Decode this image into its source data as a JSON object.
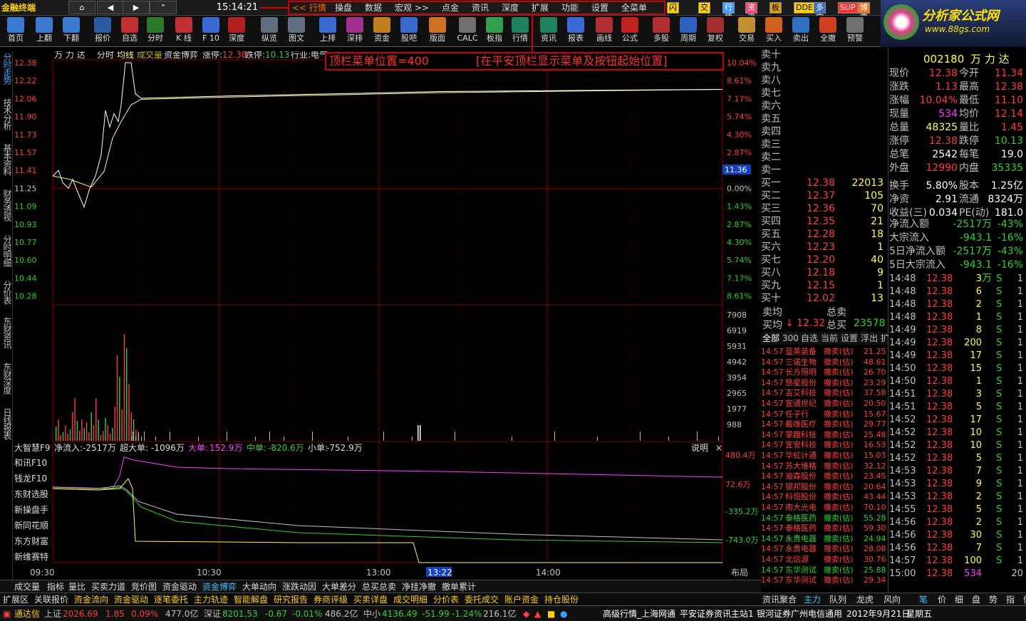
{
  "app": {
    "logo": "金融终端",
    "clock": "15:14:21",
    "nav": [
      "⌂",
      "◀",
      "▶",
      "⌃"
    ]
  },
  "topmenu": [
    "<< 行情",
    "操盘",
    "数据",
    "宏观 >>",
    "点金",
    "资讯",
    "深度",
    "扩展",
    "功能",
    "设置",
    "全菜单"
  ],
  "badges": [
    "闪电手",
    "交易",
    "行情",
    "资讯",
    "板指",
    "DDE",
    "多空",
    "SUP",
    "博弈"
  ],
  "brand": {
    "title": "分析家公式网",
    "url": "www.88gs.com"
  },
  "toolbar": [
    {
      "label": "首页",
      "color": "#3a7ad0"
    },
    {
      "label": "上翻",
      "color": "#3a7ad0"
    },
    {
      "label": "下翻",
      "color": "#3a7ad0"
    },
    {
      "label": "报价",
      "color": "#2a5aa0"
    },
    {
      "label": "自选",
      "color": "#c03030"
    },
    {
      "label": "分时",
      "color": "#2a7a2a"
    },
    {
      "label": "K 线",
      "color": "#c03030"
    },
    {
      "label": "F 10",
      "color": "#3a6ad0"
    },
    {
      "label": "深度",
      "color": "#b02020"
    },
    {
      "label": "纵览",
      "color": "#607080"
    },
    {
      "label": "图文",
      "color": "#607080"
    },
    {
      "label": "上排",
      "color": "#3a6ad0"
    },
    {
      "label": "深排",
      "color": "#a03090"
    },
    {
      "label": "资金",
      "color": "#c08020"
    },
    {
      "label": "股吧",
      "color": "#3a6ad0"
    },
    {
      "label": "版面",
      "color": "#d07020"
    },
    {
      "label": "CALC",
      "color": "#707070"
    },
    {
      "label": "板指",
      "color": "#30a050"
    },
    {
      "label": "行情",
      "color": "#208060"
    },
    {
      "label": "资讯",
      "color": "#208060"
    },
    {
      "label": "报表",
      "color": "#3a6ad0"
    },
    {
      "label": "画线",
      "color": "#b03030"
    },
    {
      "label": "公式",
      "color": "#c02020"
    },
    {
      "label": "多股",
      "color": "#b03030"
    },
    {
      "label": "周期",
      "color": "#3060c0"
    },
    {
      "label": "复权",
      "color": "#a03030"
    },
    {
      "label": "交易",
      "color": "#c09030"
    },
    {
      "label": "买入",
      "color": "#d06020"
    },
    {
      "label": "卖出",
      "color": "#3070c0"
    },
    {
      "label": "全撤",
      "color": "#d04020"
    },
    {
      "label": "预警",
      "color": "#707070"
    }
  ],
  "sidebar": [
    "分时走势",
    "技术分析",
    "基本资料",
    "财务透视",
    "分时明细",
    "分价表",
    "东财资讯",
    "东财深度",
    "日线报表"
  ],
  "overlay": {
    "left": "顶栏菜单位置=400",
    "right": "[在平安顶栏显示菜单及按钮起始位置]"
  },
  "chart_header": {
    "name": "万 力 达",
    "tabs": [
      "分时",
      "均线",
      "成交量",
      "资金博弈"
    ],
    "zt_label": "涨停:",
    "zt": "12.38",
    "dt_label": "跌停:",
    "dt": "10.13",
    "industry": "行业:电气"
  },
  "price_axis": [
    "12.38",
    "12.22",
    "12.06",
    "11.90",
    "11.73",
    "11.57",
    "11.41",
    "11.25",
    "11.09",
    "10.93",
    "10.77",
    "10.60",
    "10.44",
    "10.28"
  ],
  "pct_axis": [
    "10.04%",
    "8.61%",
    "7.17%",
    "5.74%",
    "4.30%",
    "2.87%",
    "1.43%",
    "0.00%",
    "1.43%",
    "2.87%",
    "4.30%",
    "5.74%",
    "7.17%",
    "8.61%"
  ],
  "vol_axis": [
    "7908",
    "6919",
    "5931",
    "4942",
    "3954",
    "2965",
    "1977",
    "988"
  ],
  "last_price_tag": "11.36",
  "fund_header": {
    "title": "大智慧F9",
    "net_label": "净流入:",
    "net": "-2517万",
    "super_label": "超大单:",
    "super": "-1096万",
    "big_label": "大单:",
    "big": "152.9万",
    "mid_label": "中单:",
    "mid": "-820.6万",
    "small_label": "小单:",
    "small": "-752.9万",
    "explain": "说明"
  },
  "fund_axis": [
    "480.4万",
    "72.6万",
    "-335.2万",
    "-743.0万"
  ],
  "fund_side": [
    "和讯F10",
    "钱龙F10",
    "东财选股",
    "新操盘手",
    "新同花顺",
    "东方财富",
    "新维赛特"
  ],
  "time_axis": [
    "09:30",
    "10:30",
    "13:00",
    "13:22",
    "14:00",
    "布局"
  ],
  "chart_data": {
    "type": "line",
    "x": [
      "09:30",
      "10:30",
      "13:00",
      "14:00",
      "15:00"
    ],
    "series": [
      {
        "name": "分时",
        "values": [
          11.36,
          12.06,
          12.12,
          12.14,
          12.38
        ]
      },
      {
        "name": "均线",
        "values": [
          11.3,
          12.02,
          12.1,
          12.13,
          12.14
        ]
      }
    ],
    "ylim": [
      10.13,
      12.38
    ]
  },
  "sell_book": [
    {
      "label": "卖十"
    },
    {
      "label": "卖九"
    },
    {
      "label": "卖八"
    },
    {
      "label": "卖七"
    },
    {
      "label": "卖六"
    },
    {
      "label": "卖五"
    },
    {
      "label": "卖四"
    },
    {
      "label": "卖三"
    },
    {
      "label": "卖二"
    },
    {
      "label": "卖一"
    }
  ],
  "buy_book": [
    {
      "label": "买一",
      "price": "12.38",
      "vol": "22013"
    },
    {
      "label": "买二",
      "price": "12.37",
      "vol": "105"
    },
    {
      "label": "买三",
      "price": "12.36",
      "vol": "70"
    },
    {
      "label": "买四",
      "price": "12.35",
      "vol": "21"
    },
    {
      "label": "买五",
      "price": "12.28",
      "vol": "18"
    },
    {
      "label": "买六",
      "price": "12.23",
      "vol": "1"
    },
    {
      "label": "买七",
      "price": "12.20",
      "vol": "40"
    },
    {
      "label": "买八",
      "price": "12.18",
      "vol": "9"
    },
    {
      "label": "买九",
      "price": "12.15",
      "vol": "1"
    },
    {
      "label": "买十",
      "price": "12.02",
      "vol": "13"
    }
  ],
  "book_summary": {
    "sell_avg": "卖均",
    "total_sell": "总卖",
    "buy_avg": "买均",
    "buy_avg_val": "↓ 12.32",
    "total_buy": "总买",
    "total_buy_val": "23578"
  },
  "stock_title": {
    "code": "002180",
    "name": "万 力 达"
  },
  "quote": [
    {
      "k1": "现价",
      "v1": "12.38",
      "c1": "red",
      "k2": "今开",
      "v2": "11.34",
      "c2": "red"
    },
    {
      "k1": "涨跌",
      "v1": "1.13",
      "c1": "red",
      "k2": "最高",
      "v2": "12.38",
      "c2": "red"
    },
    {
      "k1": "涨幅",
      "v1": "10.04%",
      "c1": "red",
      "k2": "最低",
      "v2": "11.10",
      "c2": "red"
    },
    {
      "k1": "现量",
      "v1": "534",
      "c1": "mag",
      "k2": "均价",
      "v2": "12.14",
      "c2": "red"
    },
    {
      "k1": "总量",
      "v1": "48325",
      "c1": "yel",
      "k2": "量比",
      "v2": "1.45",
      "c2": "red"
    },
    {
      "k1": "涨停",
      "v1": "12.38",
      "c1": "red",
      "k2": "跌停",
      "v2": "10.13",
      "c2": "grn"
    },
    {
      "k1": "总笔",
      "v1": "2542",
      "c1": "wht",
      "k2": "每笔",
      "v2": "19.0",
      "c2": "wht"
    },
    {
      "k1": "外盘",
      "v1": "12990",
      "c1": "red",
      "k2": "内盘",
      "v2": "35335",
      "c2": "grn"
    },
    {
      "k1": "换手",
      "v1": "5.80%",
      "c1": "wht",
      "k2": "股本",
      "v2": "1.25亿",
      "c2": "wht"
    },
    {
      "k1": "净资",
      "v1": "2.91",
      "c1": "wht",
      "k2": "流通",
      "v2": "8324万",
      "c2": "wht"
    },
    {
      "k1": "收益(三)",
      "v1": "0.034",
      "c1": "wht",
      "k2": "PE(动)",
      "v2": "181.0",
      "c2": "wht"
    }
  ],
  "flow": [
    {
      "k": "净流入额",
      "v": "-2517万",
      "p": "-43%"
    },
    {
      "k": "大宗流入",
      "v": "-943.1万",
      "p": "-16%"
    },
    {
      "k": "5日净流入额",
      "v": "-2517万",
      "p": "-43%"
    },
    {
      "k": "5日大宗流入",
      "v": "-943.1万",
      "p": "-16%"
    }
  ],
  "ticks": [
    {
      "t": "14:48",
      "p": "12.38",
      "v": "3",
      "s": "S",
      "n": "1"
    },
    {
      "t": "14:48",
      "p": "12.38",
      "v": "6",
      "s": "S",
      "n": "1"
    },
    {
      "t": "14:48",
      "p": "12.38",
      "v": "2",
      "s": "S",
      "n": "1"
    },
    {
      "t": "14:48",
      "p": "12.38",
      "v": "1",
      "s": "S",
      "n": "1"
    },
    {
      "t": "14:49",
      "p": "12.38",
      "v": "8",
      "s": "S",
      "n": "1"
    },
    {
      "t": "14:49",
      "p": "12.38",
      "v": "200",
      "s": "S",
      "n": "1"
    },
    {
      "t": "14:49",
      "p": "12.38",
      "v": "17",
      "s": "S",
      "n": "1"
    },
    {
      "t": "14:50",
      "p": "12.38",
      "v": "15",
      "s": "S",
      "n": "1"
    },
    {
      "t": "14:50",
      "p": "12.38",
      "v": "1",
      "s": "S",
      "n": "1"
    },
    {
      "t": "14:51",
      "p": "12.38",
      "v": "3",
      "s": "S",
      "n": "1"
    },
    {
      "t": "14:51",
      "p": "12.38",
      "v": "5",
      "s": "S",
      "n": "1"
    },
    {
      "t": "14:52",
      "p": "12.38",
      "v": "17",
      "s": "S",
      "n": "1"
    },
    {
      "t": "14:52",
      "p": "12.38",
      "v": "10",
      "s": "S",
      "n": "1"
    },
    {
      "t": "14:52",
      "p": "12.38",
      "v": "10",
      "s": "S",
      "n": "1"
    },
    {
      "t": "14:52",
      "p": "12.38",
      "v": "5",
      "s": "S",
      "n": "1"
    },
    {
      "t": "14:53",
      "p": "12.38",
      "v": "7",
      "s": "S",
      "n": "1"
    },
    {
      "t": "14:53",
      "p": "12.38",
      "v": "9",
      "s": "S",
      "n": "1"
    },
    {
      "t": "14:53",
      "p": "12.38",
      "v": "2",
      "s": "S",
      "n": "1"
    },
    {
      "t": "14:55",
      "p": "12.38",
      "v": "5",
      "s": "S",
      "n": "1"
    },
    {
      "t": "14:56",
      "p": "12.38",
      "v": "2",
      "s": "S",
      "n": "1"
    },
    {
      "t": "14:56",
      "p": "12.38",
      "v": "30",
      "s": "S",
      "n": "1"
    },
    {
      "t": "14:56",
      "p": "12.38",
      "v": "7",
      "s": "S",
      "n": "1"
    },
    {
      "t": "14:57",
      "p": "12.38",
      "v": "100",
      "s": "S",
      "n": "1"
    },
    {
      "t": "15:00",
      "p": "12.38",
      "v": "534",
      "s": "",
      "n": "20"
    }
  ],
  "deal_tabs": [
    "全部",
    "300",
    "自选",
    "当前",
    "设置",
    "浮出",
    "扩"
  ],
  "deals": [
    {
      "t": "14:57",
      "n": "蓝英装备",
      "a": "撤卖(估)",
      "p": "21.25"
    },
    {
      "t": "14:57",
      "n": "三诺生物",
      "a": "撤卖(估)",
      "p": "48.61"
    },
    {
      "t": "14:57",
      "n": "长方照明",
      "a": "撤卖(估)",
      "p": "26.70"
    },
    {
      "t": "14:57",
      "n": "慈星股份",
      "a": "撤卖(估)",
      "p": "23.29"
    },
    {
      "t": "14:57",
      "n": "吉艾科技",
      "a": "撤卖(估)",
      "p": "37.58"
    },
    {
      "t": "14:57",
      "n": "宜通世纪",
      "a": "撤卖(估)",
      "p": "20.50"
    },
    {
      "t": "14:57",
      "n": "任子行",
      "a": "撤卖(估)",
      "p": "15.67"
    },
    {
      "t": "14:57",
      "n": "戴维医疗",
      "a": "撤卖(估)",
      "p": "29.77"
    },
    {
      "t": "14:57",
      "n": "掌趣科技",
      "a": "撤卖(估)",
      "p": "25.48"
    },
    {
      "t": "14:57",
      "n": "宜安科技",
      "a": "撤卖(估)",
      "p": "16.53"
    },
    {
      "t": "14:57",
      "n": "华虹计通",
      "a": "撤卖(估)",
      "p": "15.03"
    },
    {
      "t": "14:57",
      "n": "苏大维格",
      "a": "撤卖(估)",
      "p": "32.12"
    },
    {
      "t": "14:57",
      "n": "迪森股份",
      "a": "撤卖(估)",
      "p": "23.45"
    },
    {
      "t": "14:57",
      "n": "银邦股份",
      "a": "撤卖(估)",
      "p": "20.64"
    },
    {
      "t": "14:57",
      "n": "科恒股份",
      "a": "撤卖(估)",
      "p": "43.44"
    },
    {
      "t": "14:57",
      "n": "南大光电",
      "a": "撤卖(估)",
      "p": "70.10"
    },
    {
      "t": "14:57",
      "n": "泰格医药",
      "a": "撤卖(估)",
      "p": "55.28",
      "g": true
    },
    {
      "t": "14:57",
      "n": "泰格医药",
      "a": "撤卖(估)",
      "p": "59.30"
    },
    {
      "t": "14:57",
      "n": "永贵电器",
      "a": "撤卖(估)",
      "p": "24.94",
      "g": true
    },
    {
      "t": "14:57",
      "n": "永贵电器",
      "a": "撤卖(估)",
      "p": "28.08"
    },
    {
      "t": "14:57",
      "n": "北信源",
      "a": "撤卖(估)",
      "p": "30.76"
    },
    {
      "t": "14:57",
      "n": "东华测试",
      "a": "撤卖(估)",
      "p": "25.88",
      "g": true
    },
    {
      "t": "14:57",
      "n": "东华测试",
      "a": "撤卖(估)",
      "p": "29.34"
    }
  ],
  "bottom_tabs": [
    "成交量",
    "指标",
    "量比",
    "买卖力道",
    "竞价图",
    "资金驱动",
    "资金博弈",
    "大单动向",
    "涨跌动因",
    "大单差分",
    "总买总卖",
    "净挂净撤",
    "撤单累计"
  ],
  "bottom_tabs2": [
    "扩展区",
    "关联报价",
    "资金流向",
    "资金驱动",
    "逐笔委托",
    "主力轨迹",
    "智能解盘",
    "研究报告",
    "券商评级",
    "买卖详盘",
    "成交明细",
    "分价表",
    "委托成交",
    "账户资金",
    "持仓股份"
  ],
  "right_tabs": [
    "资讯聚合",
    "主力",
    "队列",
    "龙虎",
    "风向",
    "笔",
    "价",
    "细",
    "盘",
    "势",
    "指",
    "值",
    "主"
  ],
  "status": {
    "app": "通达信",
    "sh_label": "上证",
    "sh": "2026.69",
    "sh_chg": "1.85",
    "sh_pct": "0.09%",
    "sh_amt": "477.0亿",
    "sz_label": "深证",
    "sz": "8201.53",
    "sz_chg": "-0.67",
    "sz_pct": "-0.01%",
    "sz_amt": "486.2亿",
    "zx_label": "中小",
    "zx": "4136.49",
    "zx_chg": "-51.99",
    "zx_pct": "-1.24%",
    "zx_amt": "216.1亿",
    "net": "高级行情_上海网通",
    "info": "平安证券资讯主站1",
    "conn": "银河证券广州电信通用",
    "date": "2012年9月21日",
    "week": "星期五"
  }
}
